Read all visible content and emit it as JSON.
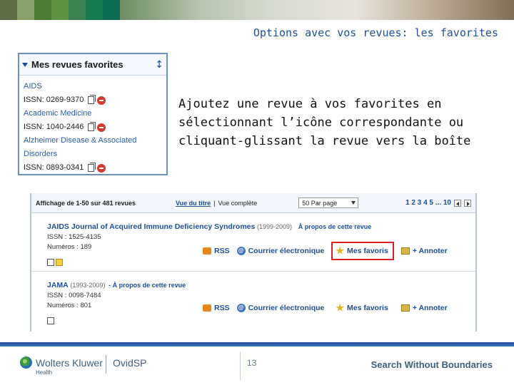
{
  "slide": {
    "title": "Options avec vos revues: les favorites",
    "explanation": "Ajoutez une revue à vos favorites en sélectionnant l’icône correspondante ou cliquant-glissant la revue vers la boîte",
    "page_number": "13"
  },
  "banner": {
    "tile_colors": [
      "#5e6c47",
      "#8aa06c",
      "#4d7a35",
      "#5f9240",
      "#3c8255",
      "#16784e",
      "#0d6b52"
    ]
  },
  "favorites_panel": {
    "title": "Mes revues favorites",
    "items": [
      {
        "name": "AIDS",
        "issn": "ISSN: 0269-9370"
      },
      {
        "name": "Academic Medicine",
        "issn": "ISSN: 1040-2446"
      },
      {
        "name": "Alzheimer Disease & Associated Disorders",
        "issn": "ISSN: 0893-0341"
      }
    ]
  },
  "results": {
    "count_label": "Affichage de 1-50 sur 481 revues",
    "view_title": "Vue du titre",
    "separator": "|",
    "view_full": "Vue complète",
    "per_page": "50   Par page",
    "pager": "1 2 3 4 5 ... 10",
    "records": [
      {
        "title": "JAIDS Journal of Acquired Immune Deficiency Syndromes",
        "years": "(1999-2009)",
        "about": "À propos de cette revue",
        "issn": "ISSN : 1525-4135",
        "issues": "Numéros : 189"
      },
      {
        "title": "JAMA",
        "years": "(1993-2009)",
        "about": "- À propos de cette revue",
        "issn": "ISSN : 0098-7484",
        "issues": "Numéros : 801"
      }
    ],
    "actions": {
      "rss": "RSS",
      "email": "Courrier électronique",
      "favorites": "Mes favoris",
      "annotate": "+ Annoter"
    }
  },
  "footer": {
    "brand": "Wolters Kluwer",
    "brand_sub": "Health",
    "product": "OvidSP",
    "tagline": "Search Without Boundaries"
  },
  "colors": {
    "accent": "#1f4e9c",
    "highlight_box": "#d6212a"
  }
}
